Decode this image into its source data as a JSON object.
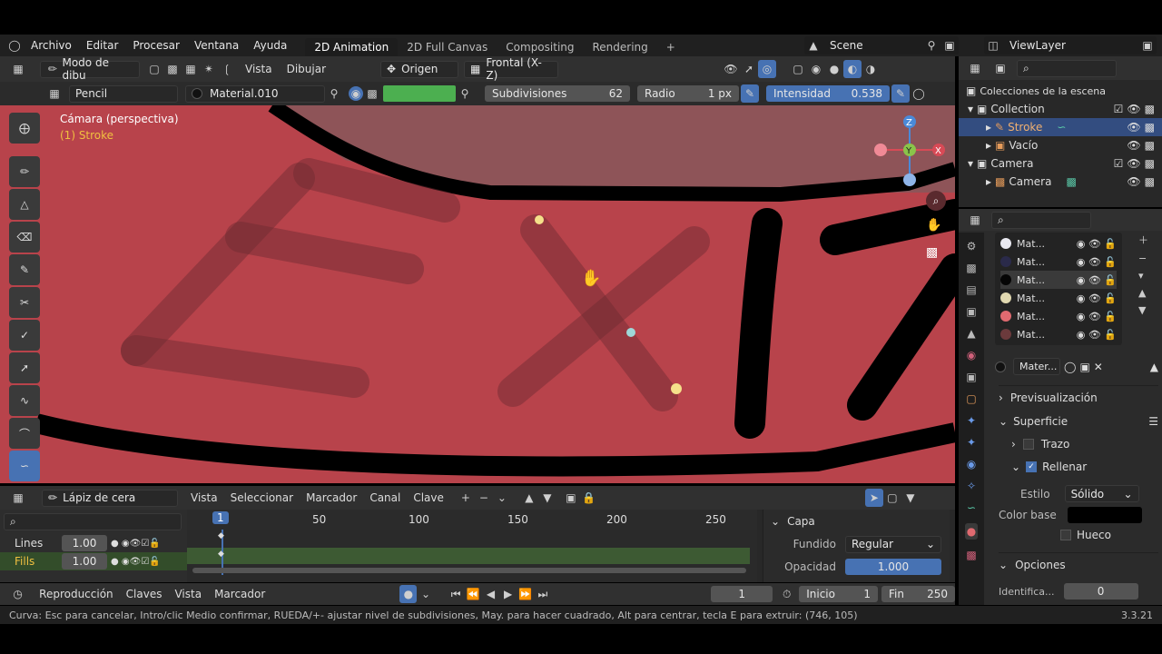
{
  "topmenu": {
    "items": [
      "Archivo",
      "Editar",
      "Procesar",
      "Ventana",
      "Ayuda"
    ]
  },
  "workspaces": {
    "tabs": [
      "2D Animation",
      "2D Full Canvas",
      "Compositing",
      "Rendering"
    ],
    "add": "+"
  },
  "scene": {
    "label": "Scene"
  },
  "viewlayer": {
    "label": "ViewLayer"
  },
  "header": {
    "mode": "Modo de dibu",
    "menus": [
      "Vista",
      "Dibujar"
    ],
    "origin": "Origen",
    "view": "Frontal (X-Z)"
  },
  "toolsettings": {
    "brush": "Pencil",
    "material": "Material.010",
    "subdiv_label": "Subdivisiones",
    "subdiv_value": "62",
    "radius_label": "Radio",
    "radius_value": "1 px",
    "intensity_label": "Intensidad",
    "intensity_value": "0.538",
    "color_fill": "#4caf50"
  },
  "viewport": {
    "camera_label": "Cámara (perspectiva)",
    "object_label": "(1) Stroke",
    "bg_color": "#b8434b",
    "gizmo": {
      "z": "Z",
      "y": "Y",
      "x": "X"
    }
  },
  "outliner": {
    "title": "Colecciones de la escena",
    "rows": [
      {
        "name": "Collection"
      },
      {
        "name": "Stroke"
      },
      {
        "name": "Vacío"
      },
      {
        "name": "Camera"
      },
      {
        "name": "Camera"
      }
    ]
  },
  "materials": {
    "list": [
      {
        "name": "Mat...",
        "color": "#e8e8f0"
      },
      {
        "name": "Mat...",
        "color": "#2a2a4a"
      },
      {
        "name": "Mat...",
        "color": "#050505"
      },
      {
        "name": "Mat...",
        "color": "#e0d8b0"
      },
      {
        "name": "Mat...",
        "color": "#e06a70"
      },
      {
        "name": "Mat...",
        "color": "#6b3a3c"
      }
    ],
    "slot": "Mater...",
    "preview": "Previsualización",
    "surface": "Superficie",
    "stroke": "Trazo",
    "fill": "Rellenar",
    "style_label": "Estilo",
    "style_value": "Sólido",
    "basecolor_label": "Color base",
    "hole": "Hueco",
    "options": "Opciones",
    "ident_label": "Identifica...",
    "ident_value": "0"
  },
  "dopesheet": {
    "mode": "Lápiz de cera",
    "menus": [
      "Vista",
      "Seleccionar",
      "Marcador",
      "Canal",
      "Clave"
    ],
    "ruler": [
      "1",
      "50",
      "100",
      "150",
      "200",
      "250"
    ],
    "layers": [
      {
        "name": "Lines",
        "value": "1.00"
      },
      {
        "name": "Fills",
        "value": "1.00"
      }
    ],
    "capa": "Capa",
    "fundido_label": "Fundido",
    "fundido_value": "Regular",
    "opacidad_label": "Opacidad",
    "opacidad_value": "1.000"
  },
  "timeline": {
    "menus": [
      "Reproducción",
      "Claves",
      "Vista",
      "Marcador"
    ],
    "frame": "1",
    "inicio_label": "Inicio",
    "inicio_value": "1",
    "fin_label": "Fin",
    "fin_value": "250"
  },
  "status": {
    "text": "Curva: Esc para cancelar, Intro/clic Medio confirmar, RUEDA/+- ajustar nivel de subdivisiones, May. para hacer cuadrado, Alt para centrar, tecla E para extruir: (746, 105)",
    "version": "3.3.21"
  }
}
